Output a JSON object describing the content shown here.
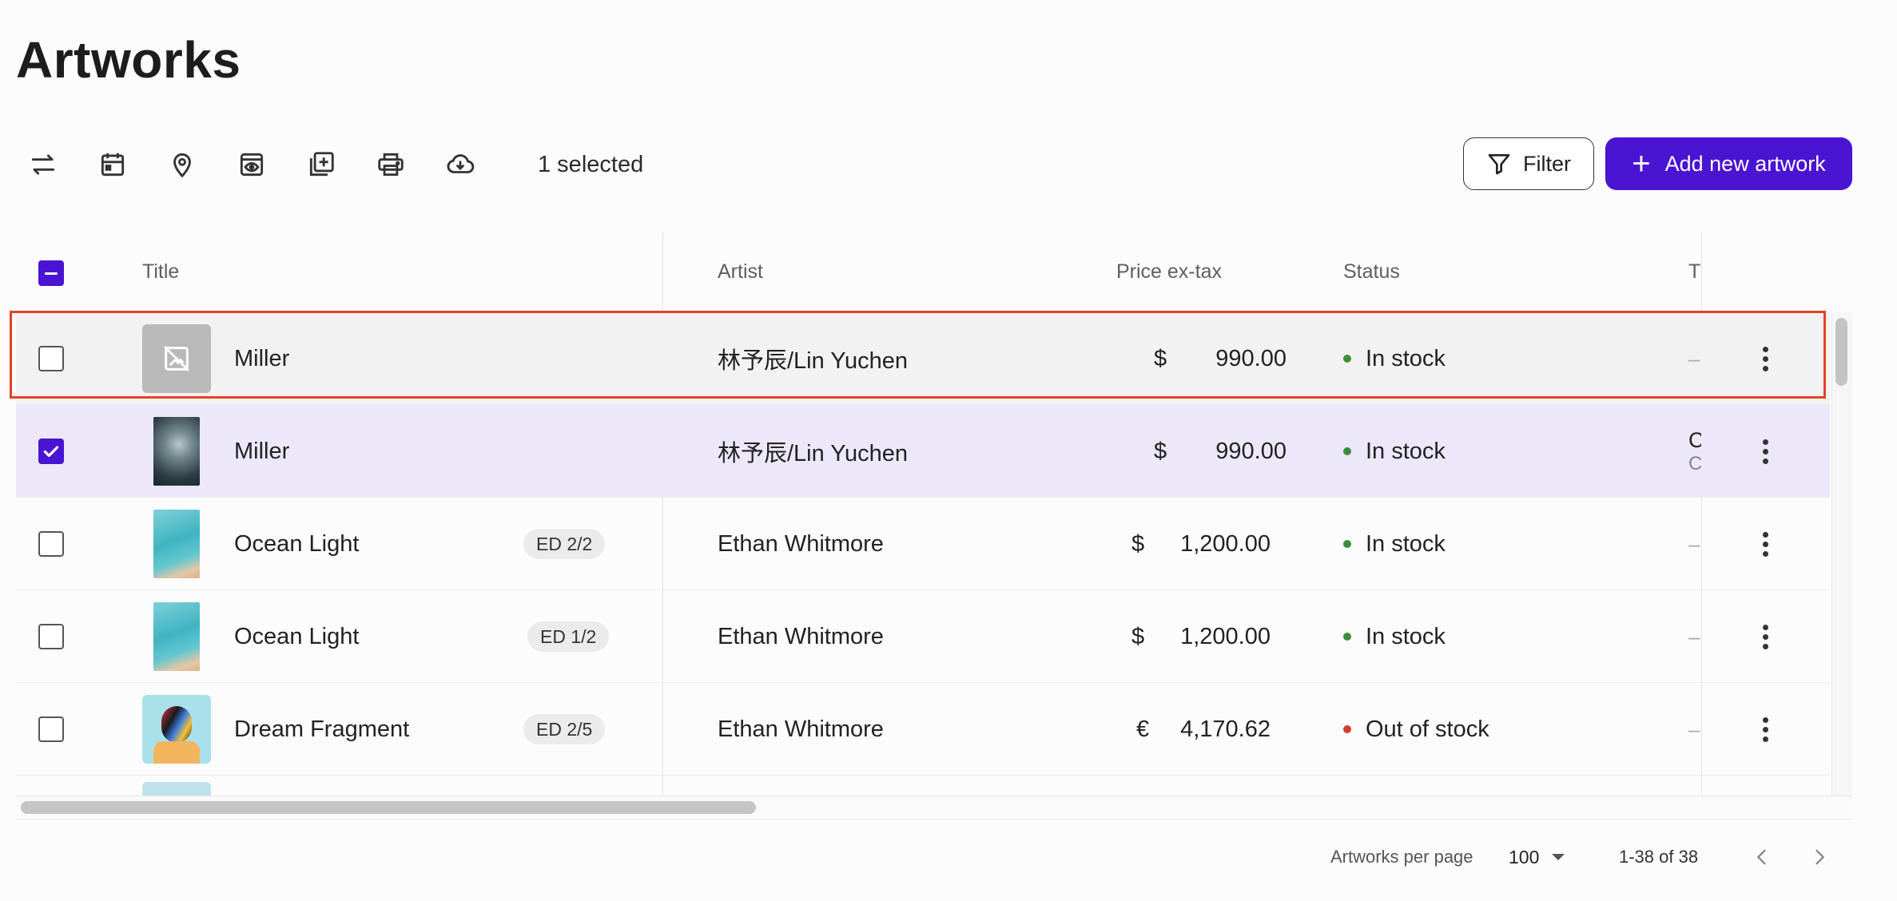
{
  "page": {
    "title": "Artworks"
  },
  "toolbar": {
    "icons": [
      "swap-arrows-icon",
      "calendar-icon",
      "location-pin-icon",
      "preview-icon",
      "add-to-collection-icon",
      "print-icon",
      "cloud-download-icon"
    ],
    "selected_label": "1 selected",
    "filter_label": "Filter",
    "add_label": "Add new artwork"
  },
  "table": {
    "columns": [
      "Title",
      "Artist",
      "Price ex-tax",
      "Status",
      "T"
    ],
    "rows": [
      {
        "title": "Miller",
        "edition": "",
        "artist": "林予辰/Lin Yuchen",
        "currency": "$",
        "price": "990.00",
        "status": "In stock",
        "status_color": "#3a8f3a",
        "extra": "–",
        "extra_sub": "",
        "checked": false,
        "state": "hovered",
        "thumb": "no-image-icon"
      },
      {
        "title": "Miller",
        "edition": "",
        "artist": "林予辰/Lin Yuchen",
        "currency": "$",
        "price": "990.00",
        "status": "In stock",
        "status_color": "#3a8f3a",
        "extra": "C",
        "extra_sub": "C",
        "checked": true,
        "state": "selected",
        "thumb": "cloud-painting"
      },
      {
        "title": "Ocean Light",
        "edition": "ED 2/2",
        "artist": "Ethan Whitmore",
        "currency": "$",
        "price": "1,200.00",
        "status": "In stock",
        "status_color": "#3a8f3a",
        "extra": "–",
        "extra_sub": "",
        "checked": false,
        "state": "normal",
        "thumb": "ocean-photo"
      },
      {
        "title": "Ocean Light",
        "edition": "ED 1/2",
        "artist": "Ethan Whitmore",
        "currency": "$",
        "price": "1,200.00",
        "status": "In stock",
        "status_color": "#3a8f3a",
        "extra": "–",
        "extra_sub": "",
        "checked": false,
        "state": "normal",
        "thumb": "ocean-photo"
      },
      {
        "title": "Dream Fragment",
        "edition": "ED 2/5",
        "artist": "Ethan Whitmore",
        "currency": "€",
        "price": "4,170.62",
        "status": "Out of stock",
        "status_color": "#d23c2f",
        "extra": "–",
        "extra_sub": "",
        "checked": false,
        "state": "normal",
        "thumb": "portrait-art"
      }
    ]
  },
  "pagination": {
    "per_page_label": "Artworks per page",
    "per_page_value": "100",
    "range_label": "1-38 of 38"
  },
  "colors": {
    "accent": "#4a14d2",
    "highlight": "#e14425",
    "in_stock": "#3a8f3a",
    "out_of_stock": "#d23c2f"
  }
}
